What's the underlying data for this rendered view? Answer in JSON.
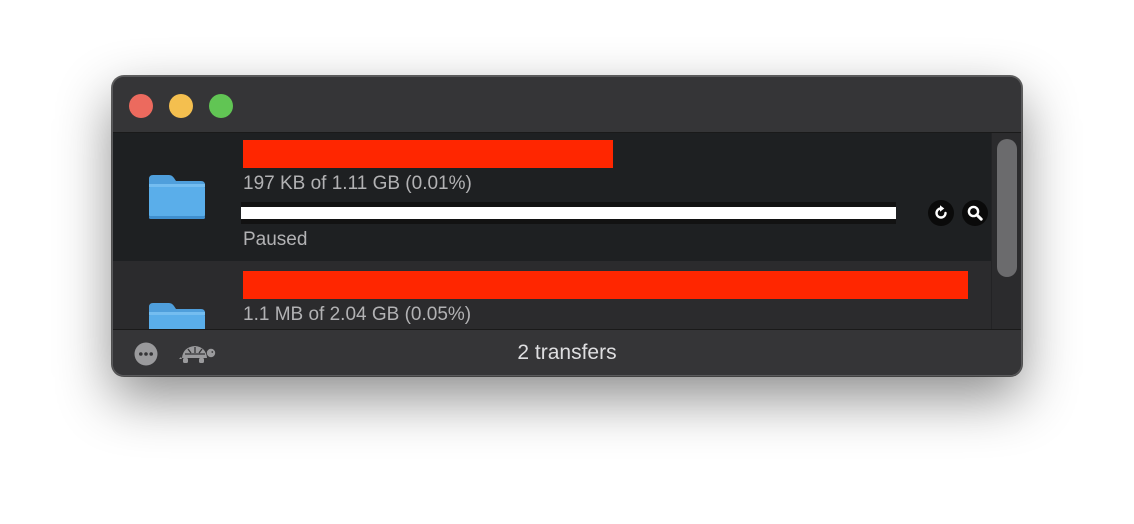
{
  "window": {
    "controls": {
      "close": "close",
      "minimize": "minimize",
      "zoom": "zoom"
    }
  },
  "transfers": [
    {
      "name_redacted_color": "#ff2600",
      "icon": "folder-icon",
      "size_text": "197 KB of 1.11 GB (0.01%)",
      "progress_fraction": 0.0001,
      "status_text": "Paused",
      "actions": [
        "reload-icon",
        "magnifier-icon"
      ],
      "selected": true
    },
    {
      "name_redacted_color": "#ff2600",
      "icon": "folder-icon",
      "size_text": "1.1 MB of 2.04 GB (0.05%)",
      "selected": false
    }
  ],
  "footer": {
    "status": "2 transfers",
    "icons": [
      "more-icon",
      "turtle-icon"
    ]
  },
  "colors": {
    "window_bg": "#2b2b2d",
    "selected_row_bg": "#1e2022",
    "redaction": "#ff2600",
    "folder_blue": "#5aaeea"
  }
}
